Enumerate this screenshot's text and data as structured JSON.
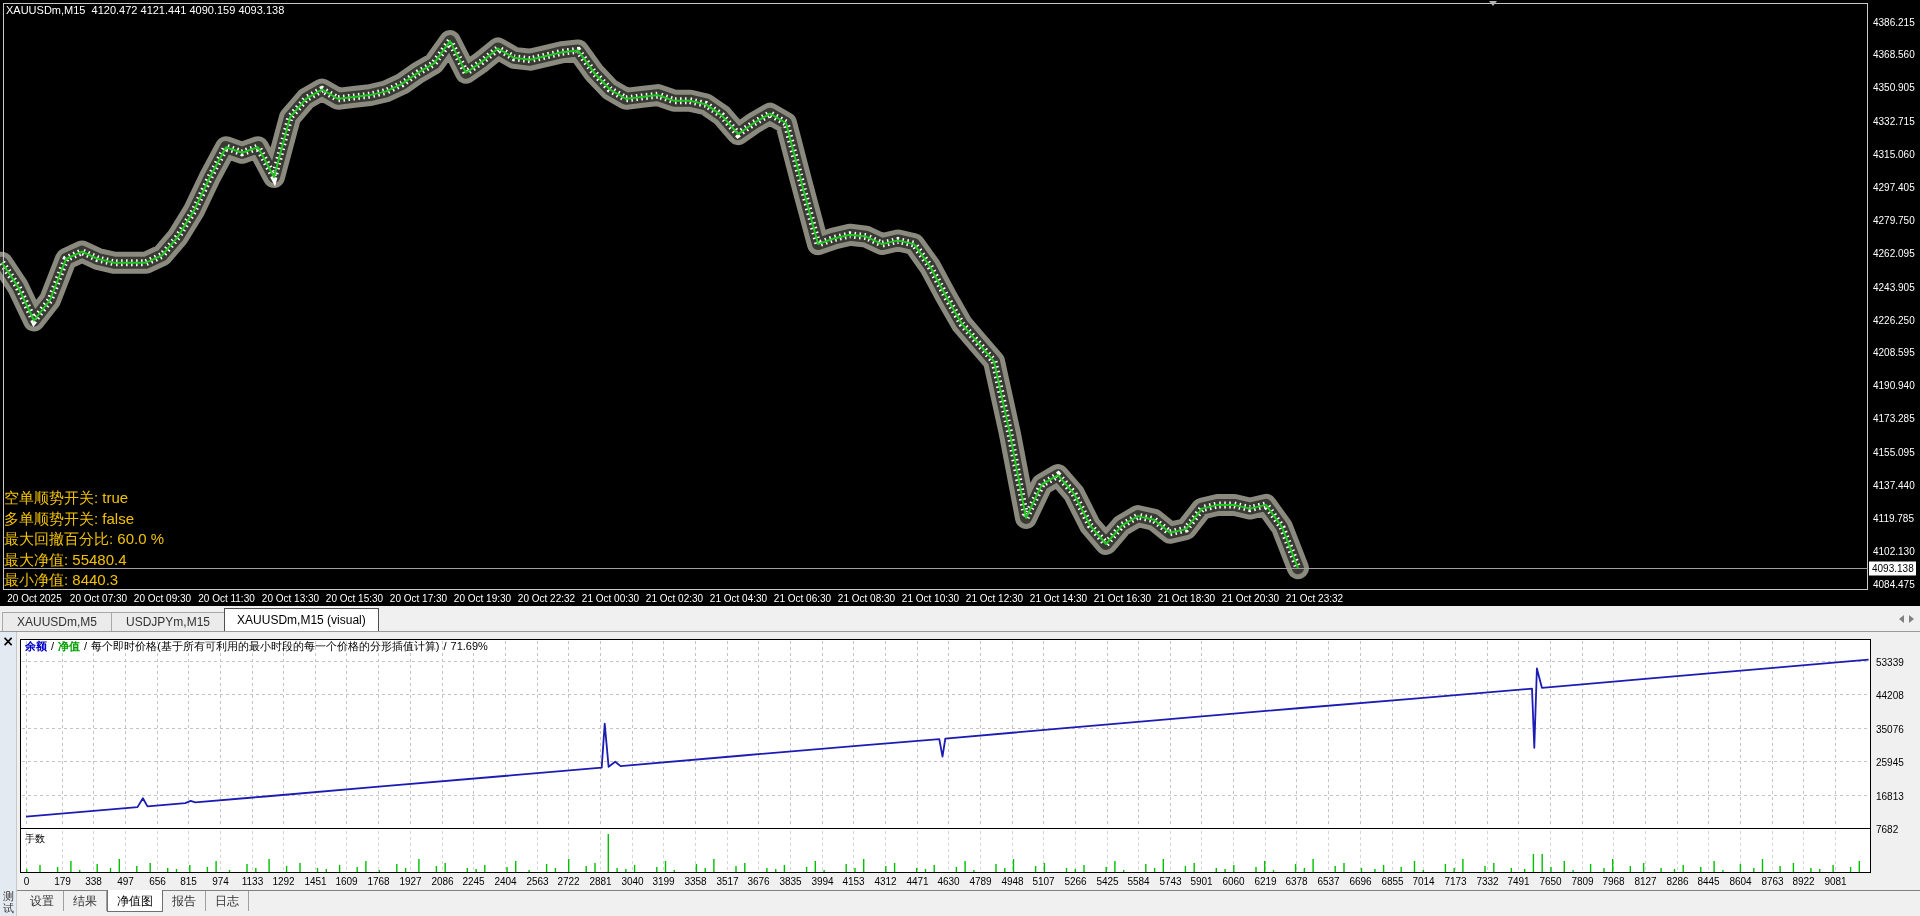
{
  "chart_window": {
    "title": "XAUUSDm,M15  4120.472 4121.441 4090.159 4093.138",
    "info_lines": [
      "空单顺势开关: true",
      "多单顺势开关: false",
      "最大回撤百分比: 60.0 %",
      "最大净值: 55480.4",
      "最小净值: 8440.3"
    ],
    "chart_data": {
      "type": "line",
      "categories": [
        null,
        null,
        "20 Oct 2025",
        null,
        null,
        null,
        "20 Oct 07:30",
        null,
        null,
        null,
        "20 Oct 09:30",
        null,
        null,
        null,
        "20 Oct 11:30",
        null,
        null,
        null,
        "20 Oct 13:30",
        null,
        null,
        null,
        "20 Oct 15:30",
        null,
        null,
        null,
        "20 Oct 17:30",
        null,
        null,
        null,
        "20 Oct 19:30",
        null,
        null,
        null,
        "20 Oct 22:32",
        null,
        null,
        null,
        "21 Oct 00:30",
        null,
        null,
        null,
        "21 Oct 02:30",
        null,
        null,
        null,
        "21 Oct 04:30",
        null,
        null,
        null,
        "21 Oct 06:30",
        null,
        null,
        null,
        "21 Oct 08:30",
        null,
        null,
        null,
        "21 Oct 10:30",
        null,
        null,
        null,
        "21 Oct 12:30",
        null,
        null,
        null,
        "21 Oct 14:30",
        null,
        null,
        null,
        "21 Oct 16:30",
        null,
        null,
        null,
        "21 Oct 18:30",
        null,
        null,
        null,
        "21 Oct 20:30",
        null,
        null,
        null,
        "21 Oct 23:32",
        null
      ],
      "series": [
        {
          "color": "#1ec81e",
          "values": [
            4257,
            4244,
            4226,
            4237,
            4259,
            4263,
            4259,
            4257,
            4257,
            4257,
            4261,
            4271,
            4285,
            4303,
            4319,
            4316,
            4319,
            4303,
            4335,
            4345,
            4350,
            4345,
            4346,
            4347,
            4349,
            4353,
            4359,
            4364,
            4376,
            4359,
            4365,
            4372,
            4367,
            4366,
            4368,
            4370,
            4371,
            4359,
            4350,
            4345,
            4346,
            4347,
            4344,
            4344,
            4342,
            4336,
            4326,
            4332,
            4337,
            4332,
            4299,
            4267,
            4270,
            4272,
            4271,
            4267,
            4269,
            4267,
            4255,
            4239,
            4224,
            4214,
            4204,
            4165,
            4120,
            4138,
            4143,
            4133,
            4116,
            4106,
            4116,
            4121,
            4119,
            4112,
            4114,
            4125,
            4127,
            4127,
            4125,
            4127,
            4115,
            4093,
            null,
            null
          ]
        }
      ],
      "ylim": [
        4081.3,
        4395.9
      ],
      "yticks": [
        {
          "value": 4386.215,
          "label": "4386.215"
        },
        {
          "value": 4368.56,
          "label": "4368.560"
        },
        {
          "value": 4350.905,
          "label": "4350.905"
        },
        {
          "value": 4332.715,
          "label": "4332.715"
        },
        {
          "value": 4315.06,
          "label": "4315.060"
        },
        {
          "value": 4297.405,
          "label": "4297.405"
        },
        {
          "value": 4279.75,
          "label": "4279.750"
        },
        {
          "value": 4262.095,
          "label": "4262.095"
        },
        {
          "value": 4243.905,
          "label": "4243.905"
        },
        {
          "value": 4226.25,
          "label": "4226.250"
        },
        {
          "value": 4208.595,
          "label": "4208.595"
        },
        {
          "value": 4190.94,
          "label": "4190.940"
        },
        {
          "value": 4173.285,
          "label": "4173.285"
        },
        {
          "value": 4155.095,
          "label": "4155.095"
        },
        {
          "value": 4137.44,
          "label": "4137.440"
        },
        {
          "value": 4119.785,
          "label": "4119.785"
        },
        {
          "value": 4102.13,
          "label": "4102.130"
        },
        {
          "value": 4084.475,
          "label": "4084.475"
        }
      ],
      "ref_lines": [
        {
          "axis": "y",
          "value": 4093.138,
          "label": "4093.138"
        }
      ]
    }
  },
  "chart_tabs": [
    {
      "label": "XAUUSDm,M5",
      "selected": false
    },
    {
      "label": "USDJPYm,M15",
      "selected": false
    },
    {
      "label": "XAUUSDm,M15 (visual)",
      "selected": true
    }
  ],
  "tester": {
    "close_button": "×",
    "side_label": "测试",
    "graph": {
      "legend": [
        {
          "kind": "series",
          "text": "余额",
          "color": "#0000c8"
        },
        {
          "kind": "separator",
          "text": "/"
        },
        {
          "kind": "series",
          "text": "净值",
          "color": "#00a000"
        },
        {
          "kind": "separator",
          "text": "/"
        },
        {
          "kind": "note",
          "text": "每个即时价格(基于所有可利用的最小时段的每一个价格的分形插值计算)"
        },
        {
          "kind": "separator",
          "text": "/"
        },
        {
          "kind": "note",
          "text": "71.69%"
        }
      ],
      "lots_label": "手数",
      "chart_data": {
        "type": "line",
        "grid": true,
        "x": [
          0,
          560,
          587,
          610,
          800,
          827,
          850,
          1200,
          1800,
          2400,
          2890,
          2905,
          2925,
          2958,
          2985,
          3600,
          4200,
          4585,
          4601,
          4615,
          5200,
          5800,
          6400,
          7000,
          7560,
          7572,
          7585,
          7610,
          8200,
          8800,
          9250
        ],
        "series": [
          {
            "color": "#1c1cb4",
            "values": [
              10800,
              13400,
              15800,
              13600,
              14500,
              15100,
              14700,
              16300,
              19100,
              21900,
              24200,
              36200,
              24400,
              25800,
              24600,
              27500,
              30300,
              32000,
              27200,
              32100,
              34900,
              37700,
              40500,
              43200,
              45800,
              29600,
              51300,
              46000,
              48800,
              51600,
              53700
            ]
          }
        ],
        "xlim": [
          -30,
          9257
        ],
        "ylim": [
          7682,
          59353
        ],
        "xticks": [
          0,
          179,
          338,
          497,
          656,
          815,
          974,
          1133,
          1292,
          1451,
          1609,
          1768,
          1927,
          2086,
          2245,
          2404,
          2563,
          2722,
          2881,
          3040,
          3199,
          3358,
          3517,
          3676,
          3835,
          3994,
          4153,
          4312,
          4471,
          4630,
          4789,
          4948,
          5107,
          5266,
          5425,
          5584,
          5743,
          5901,
          6060,
          6219,
          6378,
          6537,
          6696,
          6855,
          7014,
          7173,
          7332,
          7491,
          7650,
          7809,
          7968,
          8127,
          8286,
          8445,
          8604,
          8763,
          8922,
          9081
        ],
        "yticks": [
          53339,
          44208,
          35076,
          25945,
          16813,
          7682
        ]
      }
    },
    "tabs": [
      {
        "label": "设置",
        "selected": false
      },
      {
        "label": "结果",
        "selected": false
      },
      {
        "label": "净值图",
        "selected": true
      },
      {
        "label": "报告",
        "selected": false
      },
      {
        "label": "日志",
        "selected": false
      }
    ]
  }
}
